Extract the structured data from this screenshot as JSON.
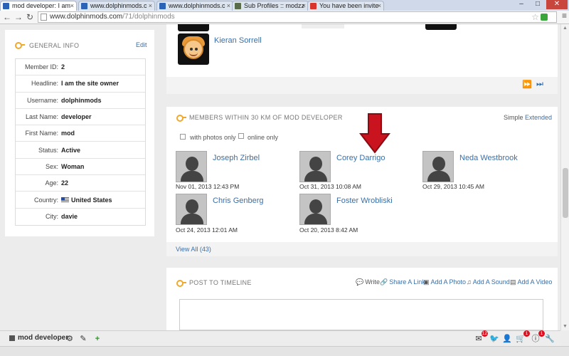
{
  "browser": {
    "tabs": [
      {
        "title": "mod developer: I am",
        "active": true,
        "fav_color": "#2b63b6"
      },
      {
        "title": "www.dolphinmods.c",
        "active": false,
        "fav_color": "#2b63b6"
      },
      {
        "title": "www.dolphinmods.c",
        "active": false,
        "fav_color": "#2b63b6"
      },
      {
        "title": "Sub Profiles :: modzz",
        "active": false,
        "fav_color": "#5a6d4a"
      },
      {
        "title": "You have been invite",
        "active": false,
        "fav_color": "#d9342b"
      }
    ],
    "url_host": "www.dolphinmods.com",
    "url_path": "/71/dolphinmods"
  },
  "general_info": {
    "title": "GENERAL INFO",
    "edit_label": "Edit",
    "rows": [
      {
        "label": "Member ID:",
        "value": "2"
      },
      {
        "label": "Headline:",
        "value": "I am the site owner"
      },
      {
        "label": "Username:",
        "value": "dolphinmods"
      },
      {
        "label": "Last Name:",
        "value": "developer"
      },
      {
        "label": "First Name:",
        "value": "mod"
      },
      {
        "label": "Status:",
        "value": "Active"
      },
      {
        "label": "Sex:",
        "value": "Woman"
      },
      {
        "label": "Age:",
        "value": "22"
      },
      {
        "label": "Country:",
        "value": "United States"
      },
      {
        "label": "City:",
        "value": "davie"
      }
    ]
  },
  "friends": {
    "visible_name": "Kieran Sorrell",
    "pager": [
      "next-icon",
      "last-icon"
    ]
  },
  "members_nearby": {
    "title": "MEMBERS WITHIN 30 KM OF MOD DEVELOPER",
    "view_simple": "Simple",
    "view_extended": "Extended",
    "filter_photos": "with photos only",
    "filter_online": "online only",
    "members": [
      {
        "name": "Joseph Zirbel",
        "date": "Nov 01, 2013 12:43 PM"
      },
      {
        "name": "Corey Darrigo",
        "date": "Oct 31, 2013 10:08 AM"
      },
      {
        "name": "Neda Westbrook",
        "date": "Oct 29, 2013 10:45 AM"
      },
      {
        "name": "Chris Genberg",
        "date": "Oct 24, 2013 12:01 AM"
      },
      {
        "name": "Foster Wrobliski",
        "date": "Oct 20, 2013 8:42 AM"
      }
    ],
    "view_all": "View All (43)"
  },
  "timeline": {
    "title": "POST TO TIMELINE",
    "actions": [
      {
        "label": "Write",
        "icon": "speech-icon"
      },
      {
        "label": "Share A Link",
        "icon": "link-icon"
      },
      {
        "label": "Add A Photo",
        "icon": "photo-icon"
      },
      {
        "label": "Add A Sound",
        "icon": "music-icon"
      },
      {
        "label": "Add A Video",
        "icon": "film-icon"
      }
    ]
  },
  "bottom_bar": {
    "user": "mod developer",
    "badges": {
      "mail": "12",
      "cart": "1",
      "info": "1"
    }
  },
  "colors": {
    "link": "#3a6fa8",
    "key": "#f0a92c",
    "arrow": "#c9131e"
  }
}
